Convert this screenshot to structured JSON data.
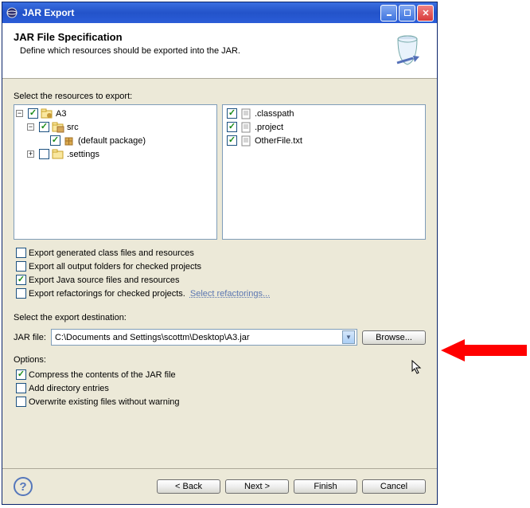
{
  "window": {
    "title": "JAR Export"
  },
  "banner": {
    "heading": "JAR File Specification",
    "subheading": "Define which resources should be exported into the JAR."
  },
  "resources_label": "Select the resources to export:",
  "left_tree": {
    "a3": {
      "name": "A3",
      "checked": true,
      "expanded": true
    },
    "src": {
      "name": "src",
      "checked": true,
      "expanded": true
    },
    "default_pkg": {
      "name": "(default package)",
      "checked": true
    },
    "settings": {
      "name": ".settings",
      "checked": false,
      "expanded": false
    }
  },
  "right_tree": [
    {
      "name": ".classpath",
      "checked": true
    },
    {
      "name": ".project",
      "checked": true
    },
    {
      "name": "OtherFile.txt",
      "checked": true
    }
  ],
  "options1": {
    "export_class": {
      "label": "Export generated class files and resources",
      "checked": false
    },
    "export_output": {
      "label": "Export all output folders for checked projects",
      "checked": false
    },
    "export_source": {
      "label": "Export Java source files and resources",
      "checked": true
    },
    "export_refactor": {
      "label": "Export refactorings for checked projects.",
      "checked": false,
      "link": "Select refactorings..."
    }
  },
  "destination": {
    "label": "Select the export destination:",
    "field_label": "JAR file:",
    "value": "C:\\Documents and Settings\\scottm\\Desktop\\A3.jar",
    "browse": "Browse..."
  },
  "options_label": "Options:",
  "options2": {
    "compress": {
      "label": "Compress the contents of the JAR file",
      "checked": true
    },
    "add_dir": {
      "label": "Add directory entries",
      "checked": false
    },
    "overwrite": {
      "label": "Overwrite existing files without warning",
      "checked": false
    }
  },
  "footer": {
    "back": "< Back",
    "next": "Next >",
    "finish": "Finish",
    "cancel": "Cancel"
  }
}
